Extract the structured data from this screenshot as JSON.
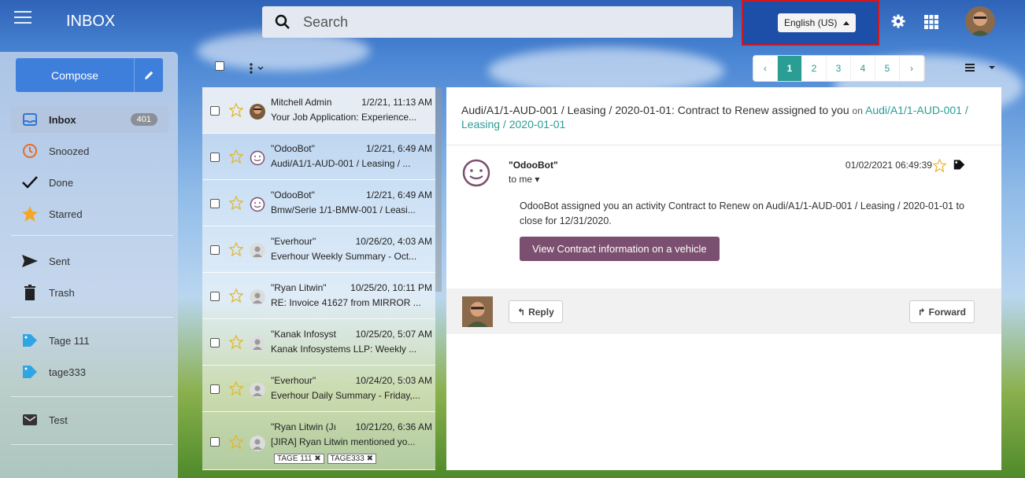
{
  "header": {
    "app_title": "INBOX",
    "search_placeholder": "Search",
    "language": "English (US)"
  },
  "sidebar": {
    "compose_label": "Compose",
    "items": [
      {
        "label": "Inbox",
        "icon": "inbox-icon",
        "count": "401",
        "active": true
      },
      {
        "label": "Snoozed",
        "icon": "clock-icon"
      },
      {
        "label": "Done",
        "icon": "check-icon"
      },
      {
        "label": "Starred",
        "icon": "star-icon"
      },
      {
        "label": "Sent",
        "icon": "send-icon"
      },
      {
        "label": "Trash",
        "icon": "trash-icon"
      },
      {
        "label": "Tage 111",
        "icon": "tag-icon"
      },
      {
        "label": "tage333",
        "icon": "tag-icon"
      },
      {
        "label": "Test",
        "icon": "mailbox-icon"
      }
    ]
  },
  "pager": {
    "prev": "‹",
    "pages": [
      "1",
      "2",
      "3",
      "4",
      "5"
    ],
    "current": "1",
    "next": "›"
  },
  "messages": [
    {
      "from": "Mitchell Admin",
      "date": "1/2/21, 11:13 AM",
      "subject": "Your Job Application: Experience..."
    },
    {
      "from": "\"OdooBot\"",
      "date": "1/2/21, 6:49 AM",
      "subject": "Audi/A1/1-AUD-001 / Leasing / ..."
    },
    {
      "from": "\"OdooBot\"",
      "date": "1/2/21, 6:49 AM",
      "subject": "Bmw/Serie 1/1-BMW-001 / Leasi..."
    },
    {
      "from": "\"Everhour\"",
      "date": "10/26/20, 4:03 AM",
      "subject": "Everhour Weekly Summary - Oct..."
    },
    {
      "from": "\"Ryan Litwin\"",
      "date": "10/25/20, 10:11 PM",
      "subject": "RE: Invoice 41627 from MIRROR ..."
    },
    {
      "from": "\"Kanak Infosyst",
      "date": "10/25/20, 5:07 AM",
      "subject": "Kanak Infosystems LLP: Weekly ..."
    },
    {
      "from": "\"Everhour\"",
      "date": "10/24/20, 5:03 AM",
      "subject": "Everhour Daily Summary - Friday,..."
    },
    {
      "from": "\"Ryan Litwin (Jı",
      "date": "10/21/20, 6:36 AM",
      "subject": "[JIRA] Ryan Litwin mentioned yo...",
      "tags": [
        "TAGE 111 ✖",
        "TAGE333 ✖"
      ]
    }
  ],
  "reading_pane": {
    "subject": "Audi/A1/1-AUD-001 / Leasing / 2020-01-01: Contract to Renew assigned to you",
    "on_word": "on",
    "record_link": "Audi/A1/1-AUD-001 / Leasing / 2020-01-01",
    "sender": "\"OdooBot\"",
    "to": "to me",
    "date": "01/02/2021 06:49:39",
    "body": "OdooBot assigned you an activity Contract to Renew on Audi/A1/1-AUD-001 / Leasing / 2020-01-01 to close for 12/31/2020.",
    "action_button": "View Contract information on a vehicle",
    "reply_label": "Reply",
    "forward_label": "Forward"
  },
  "colors": {
    "accent": "#2a9d94",
    "compose": "#3f7fdc",
    "action": "#7b4f6f",
    "highlight_border": "#d0181e"
  }
}
